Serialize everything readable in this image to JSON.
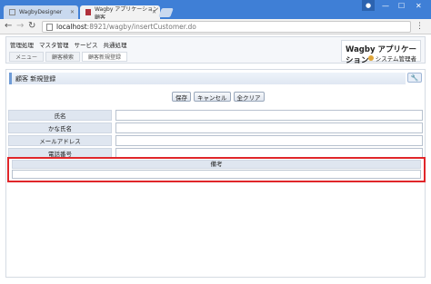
{
  "browser": {
    "tabs": [
      {
        "label": "WagbyDesigner"
      },
      {
        "label": "Wagby アプリケーション 顧客"
      }
    ],
    "address": {
      "host": "localhost",
      "path": ":8921/wagby/insertCustomer.do"
    }
  },
  "app": {
    "menu": [
      "管理処理",
      "マスタ管理",
      "サービス",
      "共通処理"
    ],
    "breadcrumbs": [
      "メニュー",
      "顧客検索",
      "顧客新規登録"
    ],
    "brand_title": "Wagby アプリケーション",
    "user": "システム管理者"
  },
  "page": {
    "title": "顧客 新規登録",
    "buttons": {
      "save": "保存",
      "cancel": "キャンセル",
      "clear": "全クリア"
    },
    "fields": [
      {
        "label": "氏名",
        "value": ""
      },
      {
        "label": "かな氏名",
        "value": ""
      },
      {
        "label": "メールアドレス",
        "value": ""
      },
      {
        "label": "電話番号",
        "value": ""
      }
    ],
    "remarks_label": "備考"
  },
  "colors": {
    "title_bar": "#3f7fd6",
    "highlight": "#e0262a"
  }
}
